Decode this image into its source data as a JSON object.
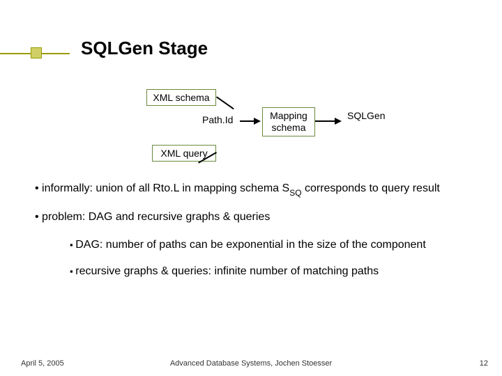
{
  "title": "SQLGen Stage",
  "diagram": {
    "xml_schema": "XML schema",
    "path_id": "Path.Id",
    "mapping_schema": "Mapping\nschema",
    "sqlgen": "SQLGen",
    "xml_query": "XML query"
  },
  "bullets": {
    "b1_pre": "informally: union of all Rto.L in mapping schema S",
    "b1_sub": "SQ",
    "b1_post": " corresponds to query result",
    "b2": "problem: DAG and recursive graphs & queries",
    "b2a": "DAG: number of paths can be exponential in the size of the component",
    "b2b": "recursive graphs & queries: infinite number of matching paths"
  },
  "footer": {
    "date": "April 5, 2005",
    "center": "Advanced Database Systems, Jochen Stoesser",
    "page": "12"
  }
}
